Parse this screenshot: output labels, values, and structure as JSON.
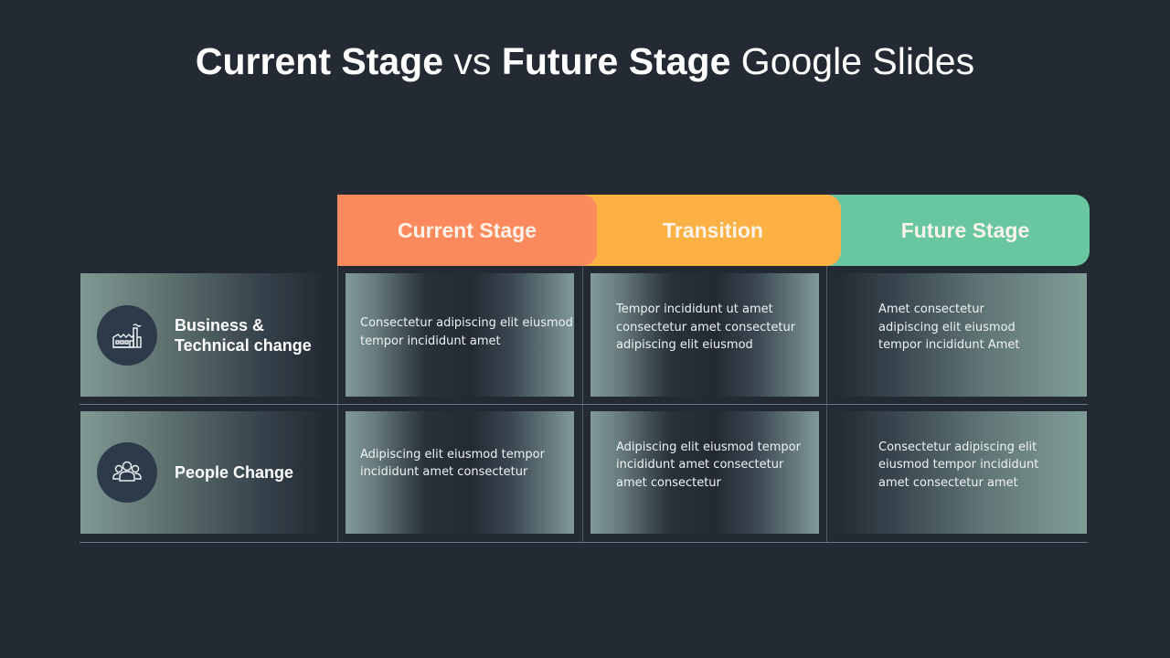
{
  "title": {
    "part1_bold": "Current Stage",
    "part2": " vs ",
    "part3_bold": "Future Stage",
    "part4": " Google Slides"
  },
  "headers": [
    {
      "label": "Current Stage",
      "color": "#fd8a5c"
    },
    {
      "label": "Transition",
      "color": "#fdb144"
    },
    {
      "label": "Future Stage",
      "color": "#68c6a1"
    }
  ],
  "rows": [
    {
      "label_line1": "Business &",
      "label_line2": "Technical change",
      "icon": "factory-icon",
      "cells": [
        "Consectetur adipiscing elit eiusmod tempor incididunt  amet",
        "Tempor incididunt ut amet consectetur amet consectetur adipiscing elit eiusmod",
        "Amet consectetur adipiscing elit eiusmod tempor incididunt  Amet"
      ]
    },
    {
      "label_line1": "People Change",
      "icon": "people-group-icon",
      "cells": [
        "Adipiscing elit eiusmod tempor incididunt  amet consectetur",
        "Adipiscing elit eiusmod tempor incididunt  amet consectetur amet consectetur",
        "Consectetur adipiscing elit eiusmod tempor incididunt amet consectetur amet"
      ]
    }
  ]
}
